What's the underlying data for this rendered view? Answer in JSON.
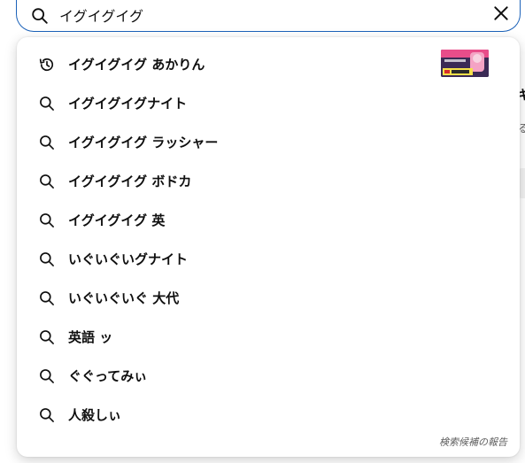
{
  "search": {
    "value": "イグイグイグ",
    "clear_icon": "close-icon"
  },
  "suggestions": [
    {
      "label": "イグイグイグ あかりん",
      "icon": "history-icon",
      "has_thumbnail": true
    },
    {
      "label": "イグイグイグナイト",
      "icon": "search-icon"
    },
    {
      "label": "イグイグイグ ラッシャー",
      "icon": "search-icon"
    },
    {
      "label": "イグイグイグ ボドカ",
      "icon": "search-icon"
    },
    {
      "label": "イグイグイグ 英",
      "icon": "search-icon"
    },
    {
      "label": "いぐいぐいグナイト",
      "icon": "search-icon"
    },
    {
      "label": "いぐいぐいぐ 大代",
      "icon": "search-icon"
    },
    {
      "label": "英語 ッ",
      "icon": "search-icon"
    },
    {
      "label": "ぐぐってみぃ",
      "icon": "search-icon"
    },
    {
      "label": "人殺しぃ",
      "icon": "search-icon"
    }
  ],
  "report_label": "検索候補の報告",
  "background": {
    "fragment_1": "キ",
    "fragment_2": "る"
  },
  "colors": {
    "focus_border": "#1c62b9",
    "text": "#0f0f0f",
    "secondary_text": "#606060"
  }
}
